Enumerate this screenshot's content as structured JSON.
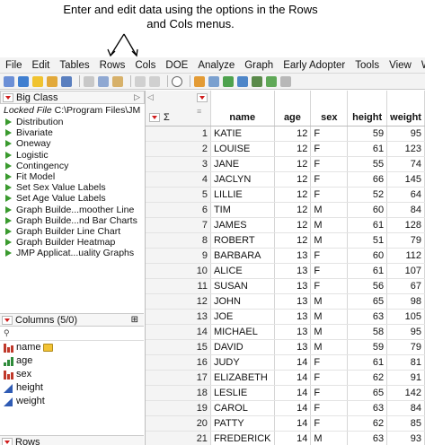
{
  "caption": "Enter and edit data using the options in the Rows and Cols menus.",
  "menu": [
    "File",
    "Edit",
    "Tables",
    "Rows",
    "Cols",
    "DOE",
    "Analyze",
    "Graph",
    "Early Adopter",
    "Tools",
    "View",
    "Win"
  ],
  "table_panel": {
    "title": "Big Class",
    "locked_file": "Locked File",
    "path": "C:\\Program Files\\JM",
    "scripts": [
      "Distribution",
      "Bivariate",
      "Oneway",
      "Logistic",
      "Contingency",
      "Fit Model",
      "Set Sex Value Labels",
      "Set Age Value Labels",
      "Graph Builde...moother Line",
      "Graph Builde...nd Bar Charts",
      "Graph Builder Line Chart",
      "Graph Builder Heatmap",
      "JMP Applicat...uality Graphs"
    ]
  },
  "columns_panel": {
    "title": "Columns (5/0)",
    "items": [
      {
        "name": "name",
        "type": "nominal",
        "icon": "nominal-icon"
      },
      {
        "name": "age",
        "type": "ordinal",
        "icon": "ordinal-icon"
      },
      {
        "name": "sex",
        "type": "nominal",
        "icon": "nominal-icon"
      },
      {
        "name": "height",
        "type": "continuous",
        "icon": "continuous-icon"
      },
      {
        "name": "weight",
        "type": "continuous",
        "icon": "continuous-icon"
      }
    ]
  },
  "rows_panel": {
    "title": "Rows"
  },
  "grid": {
    "headers": [
      "name",
      "age",
      "sex",
      "height",
      "weight"
    ],
    "rows": [
      [
        1,
        "KATIE",
        12,
        "F",
        59,
        95
      ],
      [
        2,
        "LOUISE",
        12,
        "F",
        61,
        123
      ],
      [
        3,
        "JANE",
        12,
        "F",
        55,
        74
      ],
      [
        4,
        "JACLYN",
        12,
        "F",
        66,
        145
      ],
      [
        5,
        "LILLIE",
        12,
        "F",
        52,
        64
      ],
      [
        6,
        "TIM",
        12,
        "M",
        60,
        84
      ],
      [
        7,
        "JAMES",
        12,
        "M",
        61,
        128
      ],
      [
        8,
        "ROBERT",
        12,
        "M",
        51,
        79
      ],
      [
        9,
        "BARBARA",
        13,
        "F",
        60,
        112
      ],
      [
        10,
        "ALICE",
        13,
        "F",
        61,
        107
      ],
      [
        11,
        "SUSAN",
        13,
        "F",
        56,
        67
      ],
      [
        12,
        "JOHN",
        13,
        "M",
        65,
        98
      ],
      [
        13,
        "JOE",
        13,
        "M",
        63,
        105
      ],
      [
        14,
        "MICHAEL",
        13,
        "M",
        58,
        95
      ],
      [
        15,
        "DAVID",
        13,
        "M",
        59,
        79
      ],
      [
        16,
        "JUDY",
        14,
        "F",
        61,
        81
      ],
      [
        17,
        "ELIZABETH",
        14,
        "F",
        62,
        91
      ],
      [
        18,
        "LESLIE",
        14,
        "F",
        65,
        142
      ],
      [
        19,
        "CAROL",
        14,
        "F",
        63,
        84
      ],
      [
        20,
        "PATTY",
        14,
        "F",
        62,
        85
      ],
      [
        21,
        "FREDERICK",
        14,
        "M",
        63,
        93
      ]
    ]
  },
  "colors": {
    "accent_red": "#d01c1c",
    "script_green": "#3a9a2e",
    "continuous_blue": "#2f5bb4",
    "nominal_red": "#c0392b"
  }
}
